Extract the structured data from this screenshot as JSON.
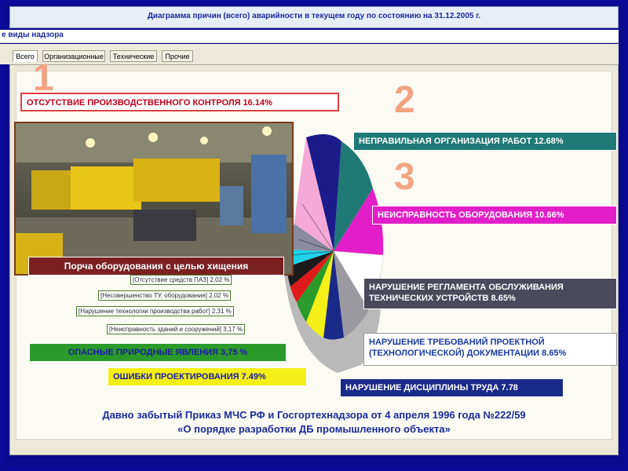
{
  "window": {
    "title": "Диаграмма причин (всего) аварийности в текущем году по состоянию на 31.12.2005 г.",
    "subtitle": "е виды надзора"
  },
  "tabs": [
    {
      "label": "Всего",
      "active": true
    },
    {
      "label": "Организационные",
      "active": false
    },
    {
      "label": "Технические",
      "active": false
    },
    {
      "label": "Прочие",
      "active": false
    }
  ],
  "markers": {
    "one": "1",
    "two": "2",
    "three": "3"
  },
  "labels": {
    "l1": "ОТСУТСТВИЕ  ПРОИЗВОДСТВЕННОГО КОНТРОЛЯ  16.14%",
    "l2": "НЕПРАВИЛЬНАЯ ОРГАНИЗАЦИЯ РАБОТ 12.68%",
    "l3": "НЕИСПРАВНОСТЬ  ОБОРУДОВАНИЯ 10.66%",
    "l4": "НАРУШЕНИЕ РЕГЛАМЕНТА ОБСЛУЖИВАНИЯ ТЕХНИЧЕСКИХ УСТРОЙСТВ  8.65%",
    "l5": "НАРУШЕНИЕ ТРЕБОВАНИЙ ПРОЕКТНОЙ (ТЕХНОЛОГИЧЕСКОЙ) ДОКУМЕНТАЦИИ 8.65%",
    "l6": "НАРУШЕНИЕ ДИСЦИПЛИНЫ  ТРУДА 7.78",
    "l7": "ОШИБКИ ПРОЕКТИРОВАНИЯ 7.49%",
    "l8": "ОПАСНЫЕ ПРИРОДНЫЕ ЯВЛЕНИЯ  3,75 %"
  },
  "small_labels": {
    "s1": "[Отсутствие средств ПАЗ]  2,02 %",
    "s2": "[Несовершенство ТУ, оборудования]  2,02 %",
    "s3": "[Нарушение технологии производства работ]  2,31 %",
    "s4": "[Неисправность зданий и сооружений]  3,17 %"
  },
  "photo_caption": "Порча  оборудования с целью хищения",
  "bottom_text": {
    "line1": "Давно  забытый Приказ МЧС РФ и Госгортехнадзора от 4 апреля 1996 года №222/59",
    "line2": "«О порядке разработки ДБ промышленного объекта»"
  },
  "colors": {
    "slice_dark_blue": "#1b1b8a",
    "slice_teal": "#1f7a76",
    "slice_magenta": "#e21ec8",
    "slice_white": "#ffffff",
    "slice_grey": "#9a9aa0",
    "slice_navy": "#1a2a88",
    "slice_yellow": "#f4ef17",
    "slice_green": "#2a9a2a",
    "slice_red": "#e01a1a"
  }
}
